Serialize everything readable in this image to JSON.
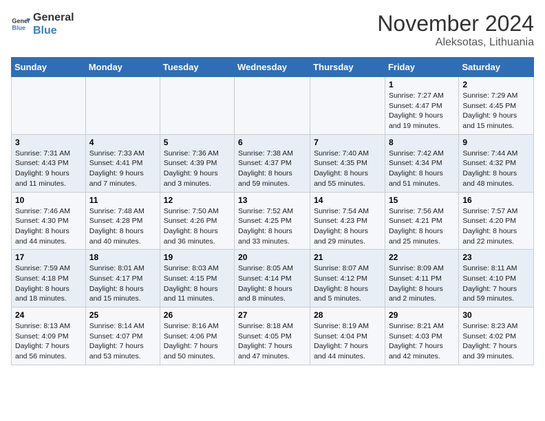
{
  "header": {
    "logo_line1": "General",
    "logo_line2": "Blue",
    "month_title": "November 2024",
    "location": "Aleksotas, Lithuania"
  },
  "weekdays": [
    "Sunday",
    "Monday",
    "Tuesday",
    "Wednesday",
    "Thursday",
    "Friday",
    "Saturday"
  ],
  "weeks": [
    [
      {
        "num": "",
        "info": ""
      },
      {
        "num": "",
        "info": ""
      },
      {
        "num": "",
        "info": ""
      },
      {
        "num": "",
        "info": ""
      },
      {
        "num": "",
        "info": ""
      },
      {
        "num": "1",
        "info": "Sunrise: 7:27 AM\nSunset: 4:47 PM\nDaylight: 9 hours\nand 19 minutes."
      },
      {
        "num": "2",
        "info": "Sunrise: 7:29 AM\nSunset: 4:45 PM\nDaylight: 9 hours\nand 15 minutes."
      }
    ],
    [
      {
        "num": "3",
        "info": "Sunrise: 7:31 AM\nSunset: 4:43 PM\nDaylight: 9 hours\nand 11 minutes."
      },
      {
        "num": "4",
        "info": "Sunrise: 7:33 AM\nSunset: 4:41 PM\nDaylight: 9 hours\nand 7 minutes."
      },
      {
        "num": "5",
        "info": "Sunrise: 7:36 AM\nSunset: 4:39 PM\nDaylight: 9 hours\nand 3 minutes."
      },
      {
        "num": "6",
        "info": "Sunrise: 7:38 AM\nSunset: 4:37 PM\nDaylight: 8 hours\nand 59 minutes."
      },
      {
        "num": "7",
        "info": "Sunrise: 7:40 AM\nSunset: 4:35 PM\nDaylight: 8 hours\nand 55 minutes."
      },
      {
        "num": "8",
        "info": "Sunrise: 7:42 AM\nSunset: 4:34 PM\nDaylight: 8 hours\nand 51 minutes."
      },
      {
        "num": "9",
        "info": "Sunrise: 7:44 AM\nSunset: 4:32 PM\nDaylight: 8 hours\nand 48 minutes."
      }
    ],
    [
      {
        "num": "10",
        "info": "Sunrise: 7:46 AM\nSunset: 4:30 PM\nDaylight: 8 hours\nand 44 minutes."
      },
      {
        "num": "11",
        "info": "Sunrise: 7:48 AM\nSunset: 4:28 PM\nDaylight: 8 hours\nand 40 minutes."
      },
      {
        "num": "12",
        "info": "Sunrise: 7:50 AM\nSunset: 4:26 PM\nDaylight: 8 hours\nand 36 minutes."
      },
      {
        "num": "13",
        "info": "Sunrise: 7:52 AM\nSunset: 4:25 PM\nDaylight: 8 hours\nand 33 minutes."
      },
      {
        "num": "14",
        "info": "Sunrise: 7:54 AM\nSunset: 4:23 PM\nDaylight: 8 hours\nand 29 minutes."
      },
      {
        "num": "15",
        "info": "Sunrise: 7:56 AM\nSunset: 4:21 PM\nDaylight: 8 hours\nand 25 minutes."
      },
      {
        "num": "16",
        "info": "Sunrise: 7:57 AM\nSunset: 4:20 PM\nDaylight: 8 hours\nand 22 minutes."
      }
    ],
    [
      {
        "num": "17",
        "info": "Sunrise: 7:59 AM\nSunset: 4:18 PM\nDaylight: 8 hours\nand 18 minutes."
      },
      {
        "num": "18",
        "info": "Sunrise: 8:01 AM\nSunset: 4:17 PM\nDaylight: 8 hours\nand 15 minutes."
      },
      {
        "num": "19",
        "info": "Sunrise: 8:03 AM\nSunset: 4:15 PM\nDaylight: 8 hours\nand 11 minutes."
      },
      {
        "num": "20",
        "info": "Sunrise: 8:05 AM\nSunset: 4:14 PM\nDaylight: 8 hours\nand 8 minutes."
      },
      {
        "num": "21",
        "info": "Sunrise: 8:07 AM\nSunset: 4:12 PM\nDaylight: 8 hours\nand 5 minutes."
      },
      {
        "num": "22",
        "info": "Sunrise: 8:09 AM\nSunset: 4:11 PM\nDaylight: 8 hours\nand 2 minutes."
      },
      {
        "num": "23",
        "info": "Sunrise: 8:11 AM\nSunset: 4:10 PM\nDaylight: 7 hours\nand 59 minutes."
      }
    ],
    [
      {
        "num": "24",
        "info": "Sunrise: 8:13 AM\nSunset: 4:09 PM\nDaylight: 7 hours\nand 56 minutes."
      },
      {
        "num": "25",
        "info": "Sunrise: 8:14 AM\nSunset: 4:07 PM\nDaylight: 7 hours\nand 53 minutes."
      },
      {
        "num": "26",
        "info": "Sunrise: 8:16 AM\nSunset: 4:06 PM\nDaylight: 7 hours\nand 50 minutes."
      },
      {
        "num": "27",
        "info": "Sunrise: 8:18 AM\nSunset: 4:05 PM\nDaylight: 7 hours\nand 47 minutes."
      },
      {
        "num": "28",
        "info": "Sunrise: 8:19 AM\nSunset: 4:04 PM\nDaylight: 7 hours\nand 44 minutes."
      },
      {
        "num": "29",
        "info": "Sunrise: 8:21 AM\nSunset: 4:03 PM\nDaylight: 7 hours\nand 42 minutes."
      },
      {
        "num": "30",
        "info": "Sunrise: 8:23 AM\nSunset: 4:02 PM\nDaylight: 7 hours\nand 39 minutes."
      }
    ]
  ]
}
